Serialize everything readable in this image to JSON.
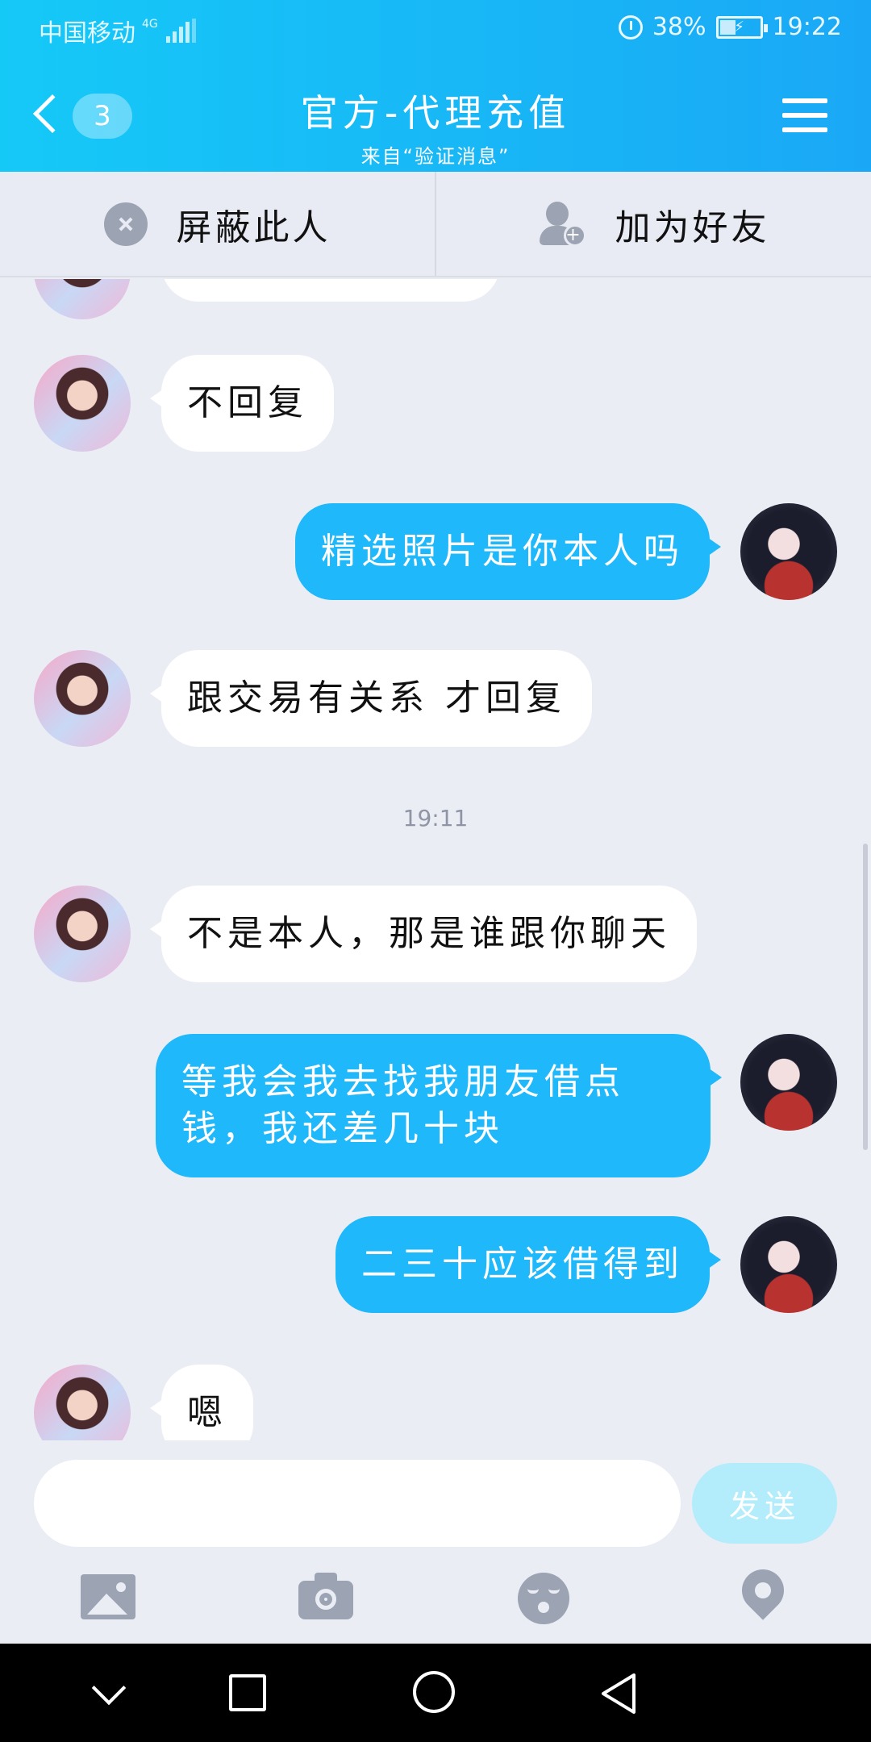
{
  "status_bar": {
    "carrier": "中国移动",
    "network": "4G",
    "battery": "38%",
    "battery_level": 0.38,
    "time": "19:22"
  },
  "header": {
    "unread_count": "3",
    "title": "官方-代理充值",
    "subtitle": "来自“验证消息”"
  },
  "actions": {
    "block_label": "屏蔽此人",
    "add_friend_label": "加为好友"
  },
  "messages": [
    {
      "side": "in",
      "text": "不回复"
    },
    {
      "side": "out",
      "text": "精选照片是你本人吗"
    },
    {
      "side": "in",
      "text": "跟交易有关系 才回复"
    },
    {
      "side": "in",
      "text": "不是本人，那是谁跟你聊天"
    },
    {
      "side": "out",
      "text": "等我会我去找我朋友借点钱，我还差几十块"
    },
    {
      "side": "out",
      "text": "二三十应该借得到"
    },
    {
      "side": "in",
      "text": "嗯"
    }
  ],
  "timestamp": "19:11",
  "input": {
    "placeholder": "",
    "send_label": "发送"
  },
  "colors": {
    "header_start": "#15c9f7",
    "header_end": "#1aa8f6",
    "outgoing_bubble": "#1fb8fa",
    "incoming_bubble": "#ffffff",
    "send_button": "#b3ecfb"
  },
  "icons": {
    "tools": [
      "photo-icon",
      "camera-icon",
      "emoji-icon",
      "location-icon"
    ],
    "system_nav": [
      "collapse-icon",
      "recents-icon",
      "home-icon",
      "back-icon"
    ]
  }
}
